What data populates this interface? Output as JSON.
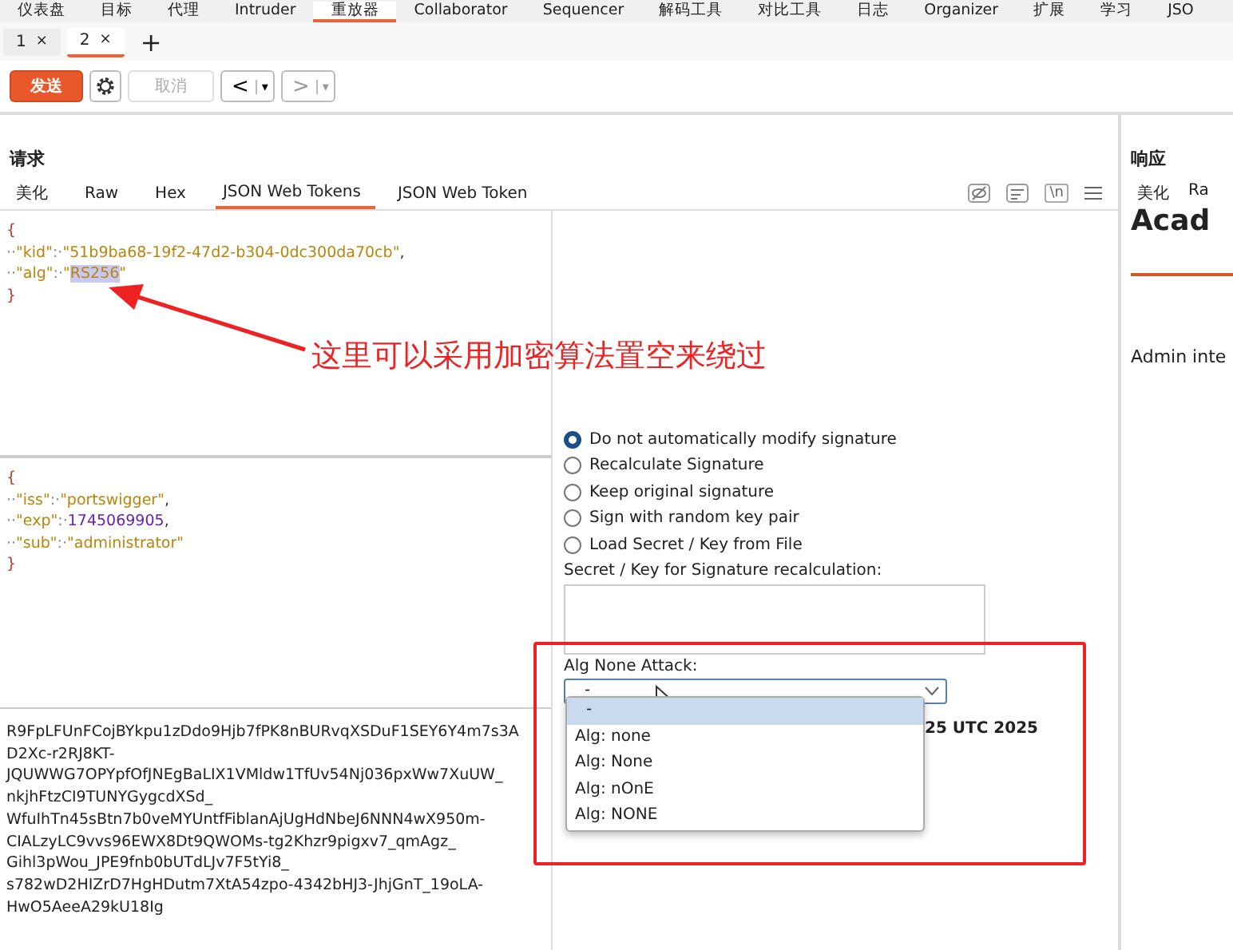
{
  "main_tabs": [
    {
      "label": "仪表盘",
      "selected": false
    },
    {
      "label": "目标",
      "selected": false
    },
    {
      "label": "代理",
      "selected": false
    },
    {
      "label": "Intruder",
      "selected": false
    },
    {
      "label": "重放器",
      "selected": true
    },
    {
      "label": "Collaborator",
      "selected": false
    },
    {
      "label": "Sequencer",
      "selected": false
    },
    {
      "label": "解码工具",
      "selected": false
    },
    {
      "label": "对比工具",
      "selected": false
    },
    {
      "label": "日志",
      "selected": false
    },
    {
      "label": "Organizer",
      "selected": false
    },
    {
      "label": "扩展",
      "selected": false
    },
    {
      "label": "学习",
      "selected": false
    },
    {
      "label": "JSO",
      "selected": false
    }
  ],
  "request_tabs": [
    {
      "label": "1",
      "close": "×",
      "selected": false
    },
    {
      "label": "2",
      "close": "×",
      "selected": true
    }
  ],
  "add_tab": "+",
  "toolbar": {
    "send": "发送",
    "cancel": "取消",
    "cancel_disabled": true,
    "back": "<",
    "forward": ">",
    "dropdown": "▾"
  },
  "request": {
    "title": "请求",
    "tabs": [
      {
        "label": "美化",
        "selected": false
      },
      {
        "label": "Raw",
        "selected": false
      },
      {
        "label": "Hex",
        "selected": false
      },
      {
        "label": "JSON Web Tokens",
        "selected": true
      },
      {
        "label": "JSON Web Token",
        "selected": false
      }
    ],
    "newline_toggle": "\\n",
    "header_lines": [
      [
        {
          "kind": "brace",
          "text": "{"
        }
      ],
      [
        {
          "kind": "ws",
          "text": "··"
        },
        {
          "kind": "key",
          "text": "\"kid\""
        },
        {
          "kind": "ws",
          "text": ":·"
        },
        {
          "kind": "str",
          "text": "\"51b9ba68-19f2-47d2-b304-0dc300da70cb\""
        },
        {
          "kind": "punct",
          "text": ","
        }
      ],
      [
        {
          "kind": "ws",
          "text": "··"
        },
        {
          "kind": "key",
          "text": "\"alg\""
        },
        {
          "kind": "ws",
          "text": ":·"
        },
        {
          "kind": "str",
          "text": "\""
        },
        {
          "kind": "str",
          "text": "RS256",
          "highlighted": true
        },
        {
          "kind": "str",
          "text": "\""
        }
      ],
      [
        {
          "kind": "brace",
          "text": "}"
        }
      ]
    ],
    "payload_lines": [
      [
        {
          "kind": "brace",
          "text": "{"
        }
      ],
      [
        {
          "kind": "ws",
          "text": "··"
        },
        {
          "kind": "key",
          "text": "\"iss\""
        },
        {
          "kind": "ws",
          "text": ":·"
        },
        {
          "kind": "str",
          "text": "\"portswigger\""
        },
        {
          "kind": "punct",
          "text": ","
        }
      ],
      [
        {
          "kind": "ws",
          "text": "··"
        },
        {
          "kind": "key",
          "text": "\"exp\""
        },
        {
          "kind": "ws",
          "text": ":·"
        },
        {
          "kind": "num",
          "text": "1745069905"
        },
        {
          "kind": "punct",
          "text": ","
        }
      ],
      [
        {
          "kind": "ws",
          "text": "··"
        },
        {
          "kind": "key",
          "text": "\"sub\""
        },
        {
          "kind": "ws",
          "text": ":·"
        },
        {
          "kind": "str",
          "text": "\"administrator\""
        }
      ],
      [
        {
          "kind": "brace",
          "text": "}"
        }
      ]
    ],
    "signature_lines": [
      "R9FpLFUnFCojBYkpu1zDdo9Hjb7fPK8nBURvqXSDuF1SEY6Y4m7s3A",
      "D2Xc-r2RJ8KT-",
      "JQUWWG7OPYpfOfJNEgBaLIX1VMldw1TfUv54Nj036pxWw7XuUW_",
      "nkjhFtzCI9TUNYGygcdXSd_",
      "WfuIhTn45sBtn7b0veMYUntfFiblanAjUgHdNbeJ6NNN4wX950m-",
      "CIALzyLC9vvs96EWX8Dt9QWOMs-tg2Khzr9pigxv7_qmAgz_",
      "Gihl3pWou_JPE9fnb0bUTdLJv7F5tYi8_",
      "s782wD2HIZrD7HgHDutm7XtA54zpo-4342bHJ3-JhjGnT_19oLA-",
      "HwO5AeeA29kU18Ig"
    ],
    "signature_options": [
      {
        "label": "Do not automatically modify signature",
        "selected": true
      },
      {
        "label": "Recalculate Signature",
        "selected": false
      },
      {
        "label": "Keep original signature",
        "selected": false
      },
      {
        "label": "Sign with random key pair",
        "selected": false
      },
      {
        "label": "Load Secret / Key from File",
        "selected": false
      }
    ],
    "secret_label": "Secret / Key for Signature recalculation:",
    "alg_none_label": "Alg None Attack:",
    "alg_none_value": "-",
    "alg_none_options": [
      {
        "label": "-",
        "selected": true
      },
      {
        "label": "Alg: none",
        "selected": false
      },
      {
        "label": "Alg: None",
        "selected": false
      },
      {
        "label": "Alg: nOnE",
        "selected": false
      },
      {
        "label": "Alg: NONE",
        "selected": false
      }
    ],
    "partial_date": "25 UTC 2025"
  },
  "response": {
    "title": "响应",
    "tabs": [
      {
        "label": "美化",
        "selected": false
      },
      {
        "label": "Ra",
        "selected": false
      }
    ],
    "heading": "Acad",
    "text": "Admin inte"
  },
  "annotation": {
    "text": "这里可以采用加密算法置空来绕过"
  }
}
